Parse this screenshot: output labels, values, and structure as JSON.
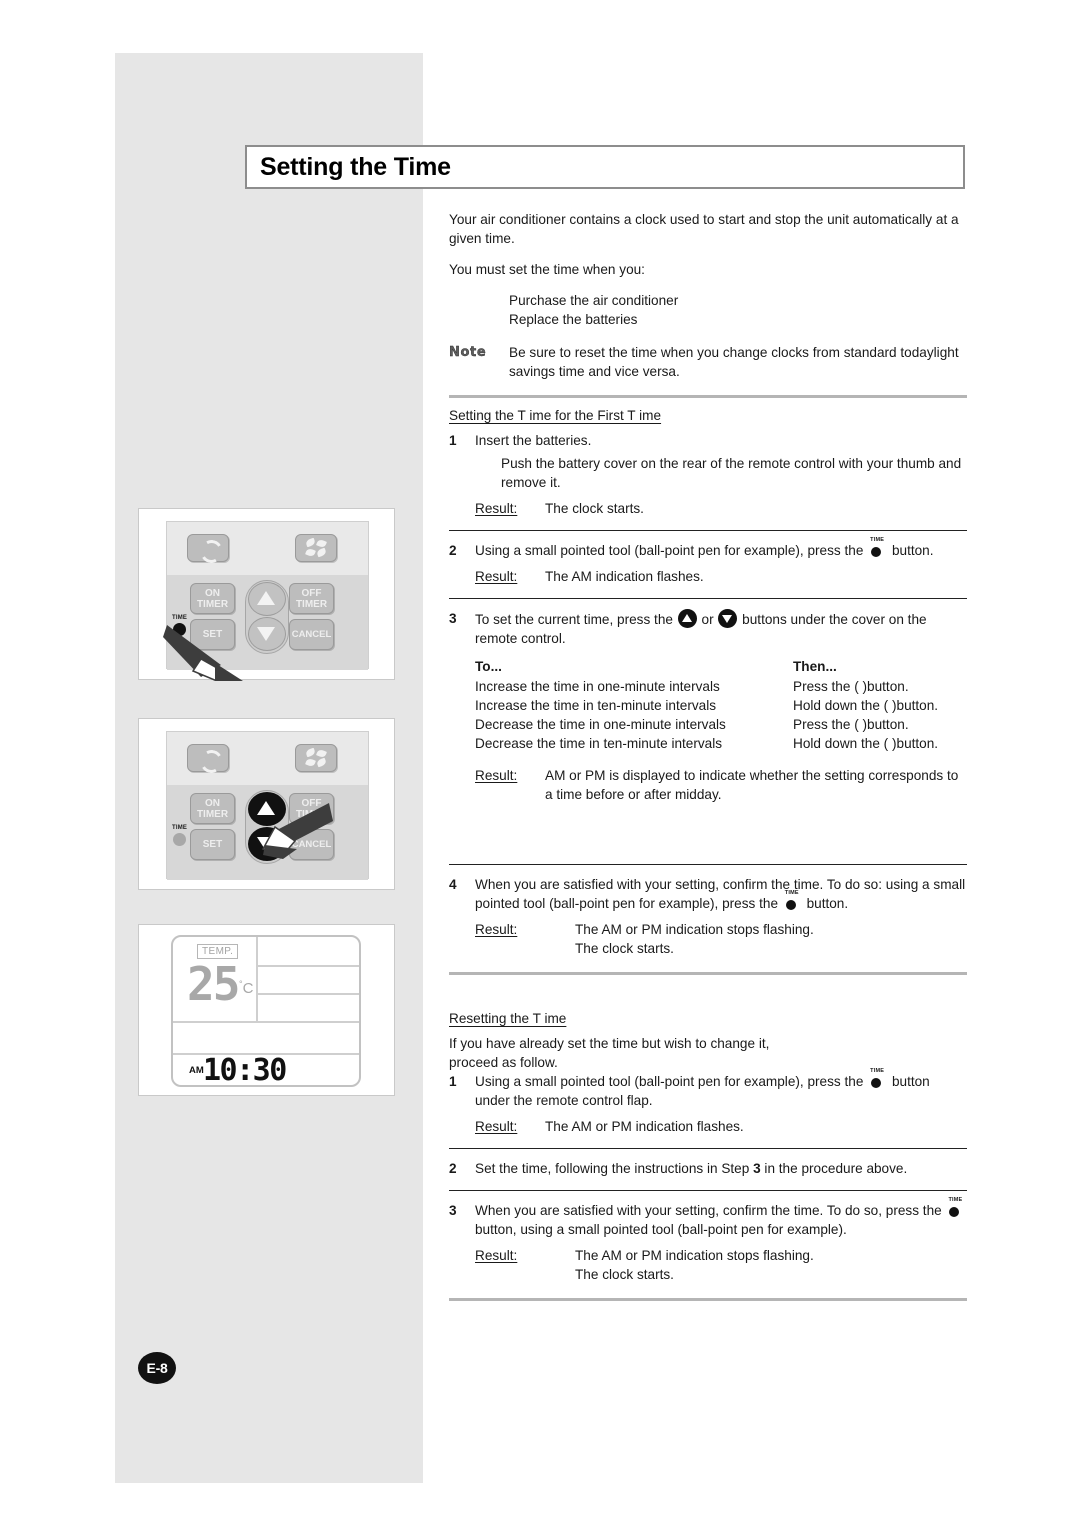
{
  "page": {
    "title": "Setting the Time",
    "page_number": "E-8"
  },
  "intro": {
    "p1": "Your air conditioner contains a clock used to start and stop the unit automatically at a given time.",
    "p2": "You must set the time when you:",
    "bullet1": "Purchase the air conditioner",
    "bullet2": "Replace the batteries",
    "note_label": "Note",
    "note_text": "Be sure to reset the time when you change clocks from standard todaylight savings time and vice versa."
  },
  "first_time": {
    "heading": "Setting the T ime for the First T ime",
    "step1": {
      "num": "1",
      "text": "Insert the batteries.",
      "detail": "Push the battery cover on the rear of the remote control with your thumb and remove it.",
      "result_label": "Result:",
      "result_text": "The clock starts."
    },
    "step2": {
      "num": "2",
      "text_before": "Using a small pointed tool (ball-point pen for example), press the",
      "text_after": "button.",
      "result_label": "Result:",
      "result_text": "The AM indication flashes."
    },
    "step3": {
      "num": "3",
      "text_before": "To set the current time, press the",
      "text_mid": "or",
      "text_after": "buttons under the cover on the remote control.",
      "table": {
        "header_to": "To...",
        "header_then": "Then...",
        "rows": [
          {
            "to": "Increase the time in one-minute intervals",
            "then": "Press the (   )button."
          },
          {
            "to": "Increase the time in ten-minute intervals",
            "then": "Hold down the (   )button."
          },
          {
            "to": "Decrease the time in one-minute intervals",
            "then": "Press the (   )button."
          },
          {
            "to": "Decrease the time in ten-minute intervals",
            "then": "Hold down the (   )button."
          }
        ]
      },
      "result_label": "Result:",
      "result_text": "AM or PM is displayed to indicate whether the setting corresponds to a time before or after midday."
    },
    "step4": {
      "num": "4",
      "text_line1": "When you are satisfied with your setting, confirm the time. To do so:",
      "text_before": "using a small pointed tool (ball-point pen for example), press the",
      "text_after": "button.",
      "result_label": "Result:",
      "result_text1": "The AM or PM indication stops flashing.",
      "result_text2": "The clock starts."
    }
  },
  "resetting": {
    "heading": "Resetting the T ime",
    "intro_line1": "If you have already set the time but wish to change it,",
    "intro_line2": "proceed as follow.",
    "step1": {
      "num": "1",
      "text_before": "Using a small pointed tool (ball-point pen for example), press the",
      "text_after": "button under the remote control flap.",
      "result_label": "Result:",
      "result_text": "The AM or PM indication flashes."
    },
    "step2": {
      "num": "2",
      "text_before": "Set the time, following the instructions in Step",
      "bold_ref": "3",
      "text_after": "in the procedure above."
    },
    "step3": {
      "num": "3",
      "text_line1": "When you are satisfied with your setting, confirm the time. To do so,",
      "text_before": "press the",
      "text_after": "button, using a small pointed tool (ball-point pen for example).",
      "result_label": "Result:",
      "result_text1": "The AM or PM indication stops flashing.",
      "result_text2": "The clock starts."
    }
  },
  "illustrations": {
    "remote": {
      "key_swing": "",
      "key_fan": "",
      "key_on_l1": "ON",
      "key_on_l2": "TIMER",
      "key_off_l1": "OFF",
      "key_off_l2": "TIMER",
      "key_set": "SET",
      "key_cancel": "CANCEL",
      "time_label": "TIME"
    },
    "display": {
      "temp_label": "TEMP.",
      "temp_value": "25",
      "temp_degree": "°",
      "temp_unit": "C",
      "clock_meridiem": "AM",
      "clock_time": "10:30"
    }
  },
  "icons": {
    "time_pin_caption": "TIME"
  }
}
